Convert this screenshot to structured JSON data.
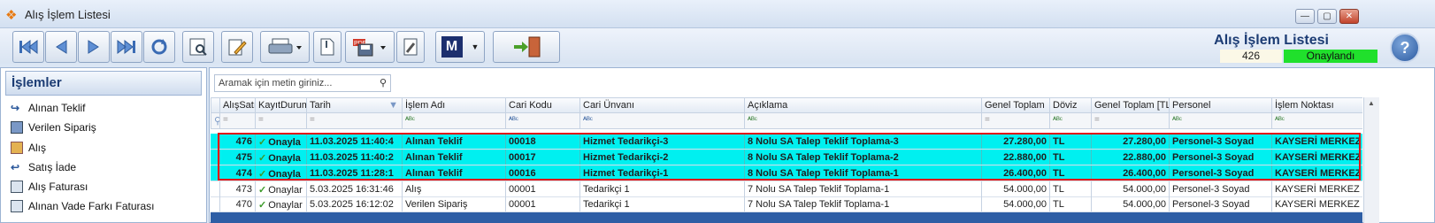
{
  "window": {
    "title": "Alış İşlem Listesi"
  },
  "header": {
    "title": "Alış İşlem Listesi",
    "count": "426",
    "status": "Onaylandı",
    "status_color": "#20e02c"
  },
  "sidebar": {
    "title": "İşlemler",
    "items": [
      {
        "label": "Alınan Teklif",
        "icon": "arrow-icon"
      },
      {
        "label": "Verilen Sipariş",
        "icon": "order-icon"
      },
      {
        "label": "Alış",
        "icon": "purchase-icon"
      },
      {
        "label": "Satış İade",
        "icon": "return-icon"
      },
      {
        "label": "Alış Faturası",
        "icon": "invoice-icon"
      },
      {
        "label": "Alınan Vade Farkı Faturası",
        "icon": "invoice-icon"
      }
    ]
  },
  "search": {
    "placeholder": "Aramak için metin giriniz..."
  },
  "grid": {
    "columns": [
      "AlışSatış",
      "KayıtDurum",
      "Tarih",
      "İşlem Adı",
      "Cari Kodu",
      "Cari Ünvanı",
      "Açıklama",
      "Genel Toplam",
      "Döviz",
      "Genel Toplam [TL]",
      "Personel",
      "İşlem Noktası"
    ],
    "rows": [
      {
        "id": "476",
        "durum": "Onayla",
        "tarih": "11.03.2025 11:40:4",
        "islem": "Alınan Teklif",
        "kod": "00018",
        "unvan": "Hizmet Tedarikçi-3",
        "aciklama": "8 Nolu SA Talep Teklif Toplama-3",
        "toplam": "27.280,00",
        "doviz": "TL",
        "toplam_tl": "27.280,00",
        "personel": "Personel-3 Soyad",
        "nokta": "KAYSERİ MERKEZ"
      },
      {
        "id": "475",
        "durum": "Onayla",
        "tarih": "11.03.2025 11:40:2",
        "islem": "Alınan Teklif",
        "kod": "00017",
        "unvan": "Hizmet Tedarikçi-2",
        "aciklama": "8 Nolu SA Talep Teklif Toplama-2",
        "toplam": "22.880,00",
        "doviz": "TL",
        "toplam_tl": "22.880,00",
        "personel": "Personel-3 Soyad",
        "nokta": "KAYSERİ MERKEZ"
      },
      {
        "id": "474",
        "durum": "Onayla",
        "tarih": "11.03.2025 11:28:1",
        "islem": "Alınan Teklif",
        "kod": "00016",
        "unvan": "Hizmet Tedarikçi-1",
        "aciklama": "8 Nolu SA Talep Teklif Toplama-1",
        "toplam": "26.400,00",
        "doviz": "TL",
        "toplam_tl": "26.400,00",
        "personel": "Personel-3 Soyad",
        "nokta": "KAYSERİ MERKEZ"
      },
      {
        "id": "473",
        "durum": "Onaylar",
        "tarih": "5.03.2025 16:31:46",
        "islem": "Alış",
        "kod": "00001",
        "unvan": "Tedarikçi 1",
        "aciklama": "7 Nolu SA Talep Teklif Toplama-1",
        "toplam": "54.000,00",
        "doviz": "TL",
        "toplam_tl": "54.000,00",
        "personel": "Personel-3 Soyad",
        "nokta": "KAYSERİ MERKEZ"
      },
      {
        "id": "470",
        "durum": "Onaylar",
        "tarih": "5.03.2025 16:12:02",
        "islem": "Verilen Sipariş",
        "kod": "00001",
        "unvan": "Tedarikçi 1",
        "aciklama": "7 Nolu SA Talep Teklif Toplama-1",
        "toplam": "54.000,00",
        "doviz": "TL",
        "toplam_tl": "54.000,00",
        "personel": "Personel-3 Soyad",
        "nokta": "KAYSERİ MERKEZ"
      }
    ]
  },
  "toolbar": {
    "m_label": "M"
  }
}
